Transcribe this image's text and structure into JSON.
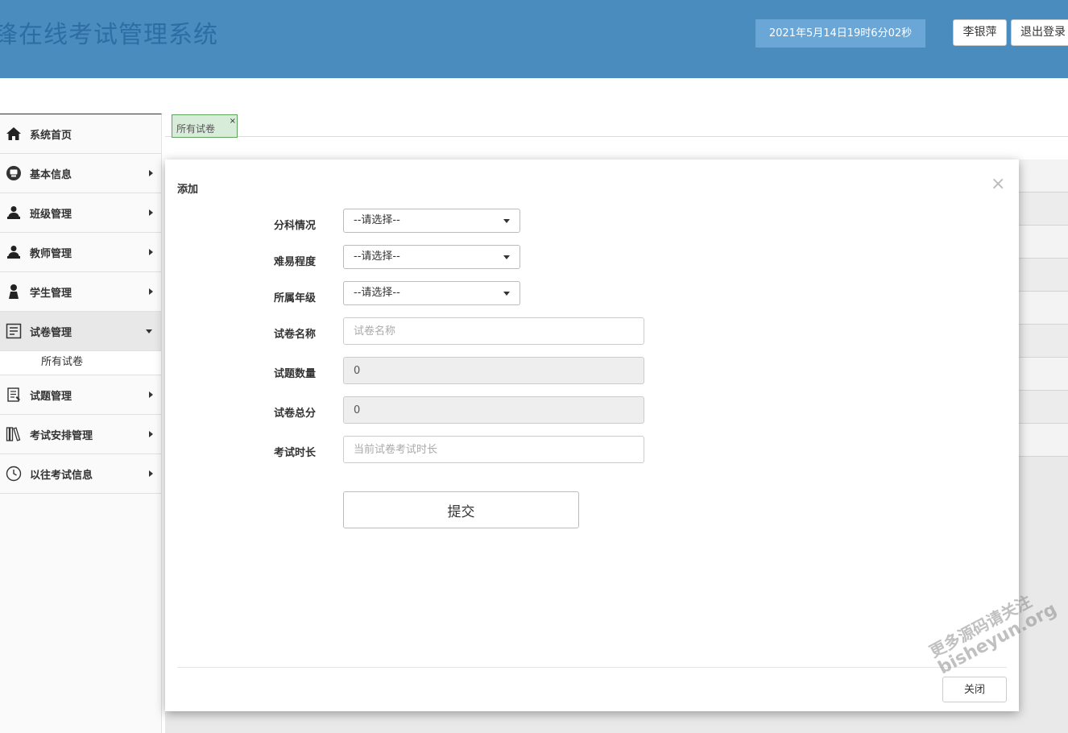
{
  "header": {
    "app_title": "锋在线考试管理系统",
    "clock": "2021年5月14日19时6分02秒",
    "user_button": "李银萍",
    "logout_button": "退出登录"
  },
  "sidebar": {
    "items": [
      {
        "label": "系统首页",
        "icon": "home-icon"
      },
      {
        "label": "基本信息",
        "icon": "info-icon"
      },
      {
        "label": "班级管理",
        "icon": "class-icon"
      },
      {
        "label": "教师管理",
        "icon": "teacher-icon"
      },
      {
        "label": "学生管理",
        "icon": "student-icon"
      },
      {
        "label": "试卷管理",
        "icon": "paper-icon",
        "expanded": true
      },
      {
        "label": "试题管理",
        "icon": "question-icon"
      },
      {
        "label": "考试安排管理",
        "icon": "books-icon"
      },
      {
        "label": "以往考试信息",
        "icon": "clock-icon"
      }
    ],
    "sub_items": [
      "所有试卷"
    ]
  },
  "tabs": [
    {
      "label": "所有试卷",
      "close": "×"
    }
  ],
  "modal": {
    "title": "添加",
    "close": "×",
    "fields": {
      "subject": {
        "label": "分科情况",
        "value": "--请选择--"
      },
      "difficulty": {
        "label": "难易程度",
        "value": "--请选择--"
      },
      "grade": {
        "label": "所属年级",
        "value": "--请选择--"
      },
      "paper_name": {
        "label": "试卷名称",
        "placeholder": "试卷名称"
      },
      "question_count": {
        "label": "试题数量",
        "value": "0"
      },
      "total_score": {
        "label": "试卷总分",
        "value": "0"
      },
      "duration": {
        "label": "考试时长",
        "placeholder": "当前试卷考试时长"
      }
    },
    "submit": "提交",
    "footer_button": "关闭"
  },
  "watermark": {
    "line1": "更多源码请关注",
    "line2": "bisheyun.org"
  },
  "colors": {
    "header_bg": "#4a8cbd",
    "clock_bg": "#6aa6d6",
    "tab_bg": "#d7ecd9",
    "tab_border": "#5fa35f"
  }
}
